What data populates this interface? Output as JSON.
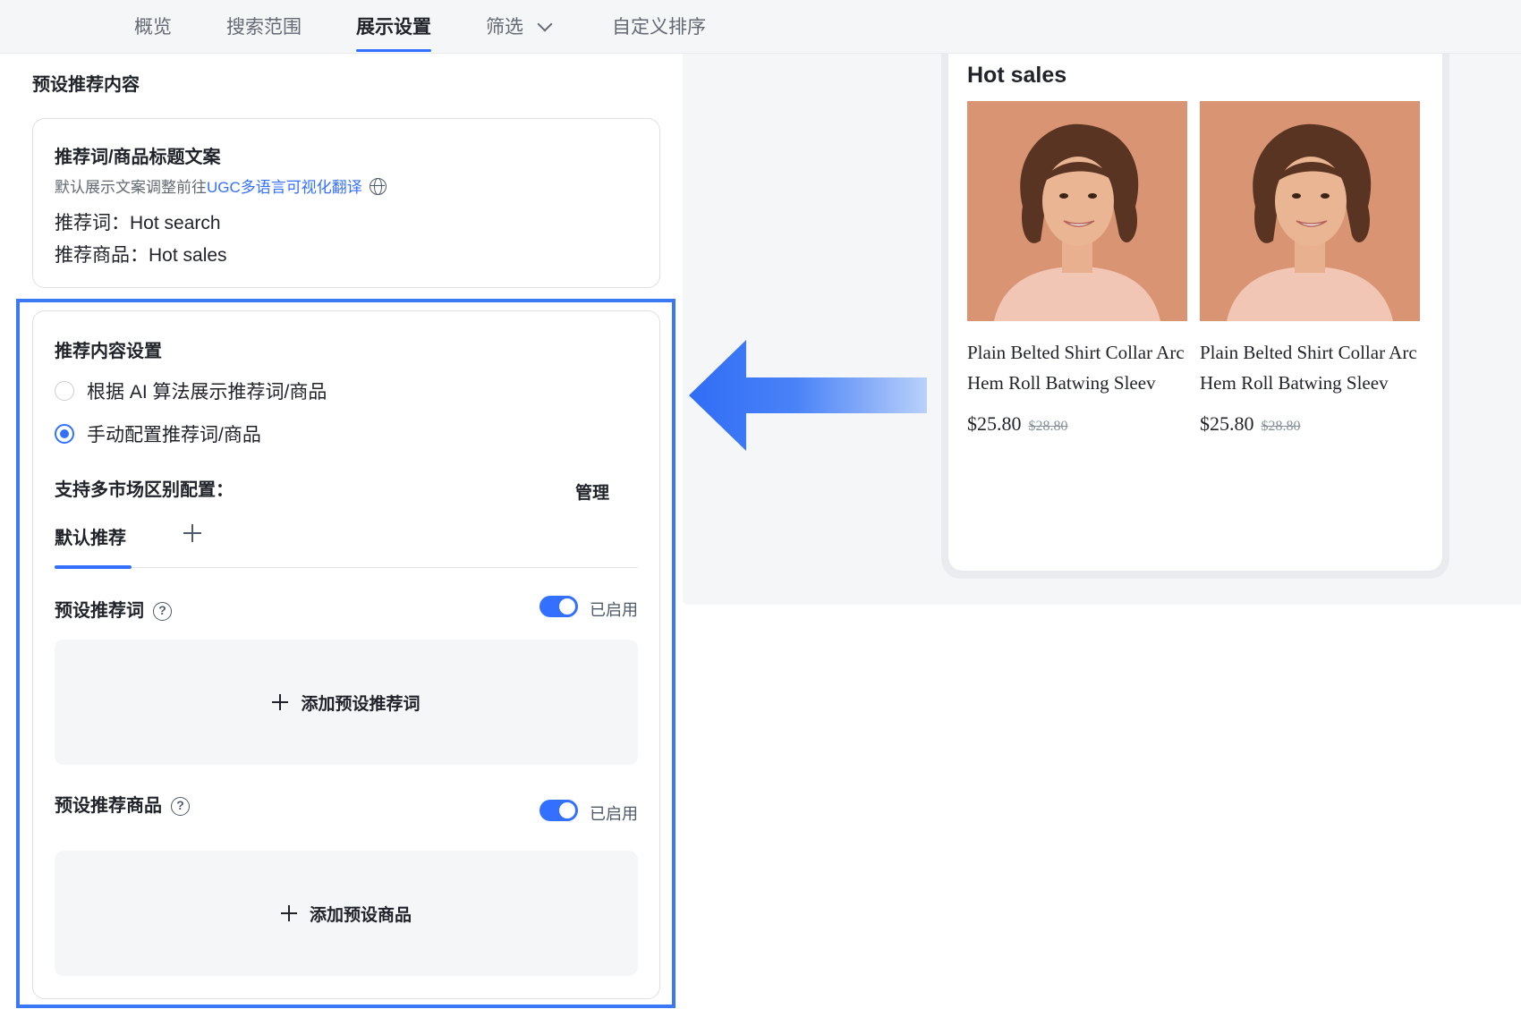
{
  "tabs": [
    {
      "label": "概览",
      "active": false
    },
    {
      "label": "搜索范围",
      "active": false
    },
    {
      "label": "展示设置",
      "active": true
    },
    {
      "label": "筛选",
      "active": false,
      "has_dropdown": true
    },
    {
      "label": "自定义排序",
      "active": false
    }
  ],
  "left": {
    "section_title": "预设推荐内容",
    "copy_card": {
      "title": "推荐词/商品标题文案",
      "hint_prefix": "默认展示文案调整前往",
      "hint_link": "UGC多语言可视化翻译",
      "hint_icon": "globe-icon",
      "words_line": "推荐词：Hot search",
      "products_line": "推荐商品：Hot sales"
    },
    "rec_card": {
      "title": "推荐内容设置",
      "options": [
        {
          "label": "根据 AI 算法展示推荐词/商品",
          "selected": false
        },
        {
          "label": "手动配置推荐词/商品",
          "selected": true
        }
      ],
      "multi_market_label": "支持多市场区别配置：",
      "manage_label": "管理",
      "subtab_default": "默认推荐",
      "preset_words": {
        "label": "预设推荐词",
        "enabled": true,
        "status": "已启用",
        "add_label": "添加预设推荐词"
      },
      "preset_products": {
        "label": "预设推荐商品",
        "enabled": true,
        "status": "已启用",
        "add_label": "添加预设商品"
      }
    }
  },
  "preview": {
    "title": "Hot sales",
    "products": [
      {
        "name": "Plain Belted Shirt Collar Arc Hem Roll Batwing Sleev",
        "price": "$25.80",
        "old_price": "$28.80"
      },
      {
        "name": "Plain Belted Shirt Collar Arc Hem Roll Batwing Sleev",
        "price": "$25.80",
        "old_price": "$28.80"
      }
    ]
  },
  "colors": {
    "accent": "#3370ff",
    "highlight_border": "#3b78f6",
    "product_bg": "#d99573"
  }
}
